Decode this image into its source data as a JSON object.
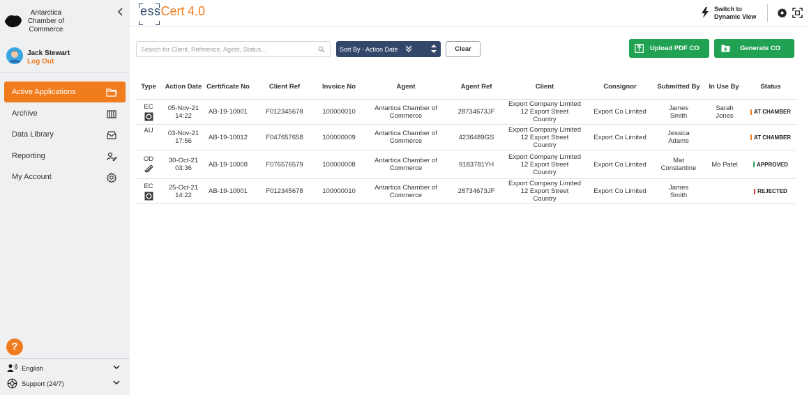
{
  "sidebar": {
    "org_name": "Antarctica Chamber of Commerce",
    "user": {
      "name": "Jack Stewart",
      "logout": "Log Out"
    },
    "nav": [
      {
        "label": "Active Applications",
        "icon": "folder-icon",
        "active": true
      },
      {
        "label": "Archive",
        "icon": "archive-icon",
        "active": false
      },
      {
        "label": "Data Library",
        "icon": "inbox-icon",
        "active": false
      },
      {
        "label": "Reporting",
        "icon": "report-icon",
        "active": false
      },
      {
        "label": "My Account",
        "icon": "gear-icon",
        "active": false
      }
    ],
    "help": "?",
    "language": "English",
    "support": "Support (24/7)"
  },
  "header": {
    "brand_ess": "ess",
    "brand_cert": "Cert",
    "brand_ver": "4.0",
    "switch_line1": "Switch to",
    "switch_line2": "Dynamic View"
  },
  "toolbar": {
    "search_placeholder": "Search for Client, Reference, Agent, Status...",
    "sort_label": "Sort By - Action Date",
    "clear_label": "Clear",
    "upload_label": "Upload PDF CO",
    "generate_label": "Generate CO"
  },
  "colors": {
    "accent": "#f07c1e",
    "navy": "#33476b",
    "green": "#21a152",
    "status_at_chamber": "#f07c1e",
    "status_approved": "#21a152",
    "status_rejected": "#e03131"
  },
  "table": {
    "columns": [
      "Type",
      "Action Date",
      "Certificate No",
      "Client Ref",
      "Invoice No",
      "Agent",
      "Agent Ref",
      "Client",
      "Consignor",
      "Submitted By",
      "In Use By",
      "Status"
    ],
    "rows": [
      {
        "type": "EC",
        "type_icon": "seal-icon",
        "date": "05-Nov-21",
        "time": "14:22",
        "cert": "AB-19-10001",
        "client_ref": "F012345678",
        "invoice": "100000010",
        "agent": "Antartica Chamber of Commerce",
        "agent_ref": "28734673JF",
        "client1": "Export Company Limited",
        "client2": "12 Export Street",
        "client3": "Country",
        "consignor": "Export Co Limited",
        "submitted": "James Smith",
        "in_use": "Sarah Jones",
        "status": "AT CHAMBER",
        "status_color": "#f07c1e"
      },
      {
        "type": "AU",
        "type_icon": "",
        "date": "03-Nov-21",
        "time": "17:56",
        "cert": "AB-19-10012",
        "client_ref": "F047657658",
        "invoice": "100000009",
        "agent": "Antartica Chamber of Commerce",
        "agent_ref": "4236489GS",
        "client1": "Export Company Limited",
        "client2": "12 Export Street",
        "client3": "Country",
        "consignor": "Export Co Limited",
        "submitted": "Jessica Adams",
        "in_use": "",
        "status": "AT CHAMBER",
        "status_color": "#f07c1e"
      },
      {
        "type": "OD",
        "type_icon": "paperclip-icon",
        "date": "30-Oct-21",
        "time": "03:36",
        "cert": "AB-19-10008",
        "client_ref": "F076576579",
        "invoice": "100000008",
        "agent": "Antartica Chamber of Commerce",
        "agent_ref": "9183781YH",
        "client1": "Export Company Limited",
        "client2": "12 Export Street",
        "client3": "Country",
        "consignor": "Export Co Limited",
        "submitted": "Mat Constantine",
        "in_use": "Mo Patel",
        "status": "APPROVED",
        "status_color": "#21a152"
      },
      {
        "type": "EC",
        "type_icon": "seal-icon",
        "date": "25-Oct-21",
        "time": "14:22",
        "cert": "AB-19-10001",
        "client_ref": "F012345678",
        "invoice": "100000010",
        "agent": "Antartica Chamber of Commerce",
        "agent_ref": "28734673JF",
        "client1": "Export Company Limited",
        "client2": "12 Export Street",
        "client3": "Country",
        "consignor": "Export Co Limited",
        "submitted": "James Smith",
        "in_use": "",
        "status": "REJECTED",
        "status_color": "#e03131"
      }
    ]
  }
}
